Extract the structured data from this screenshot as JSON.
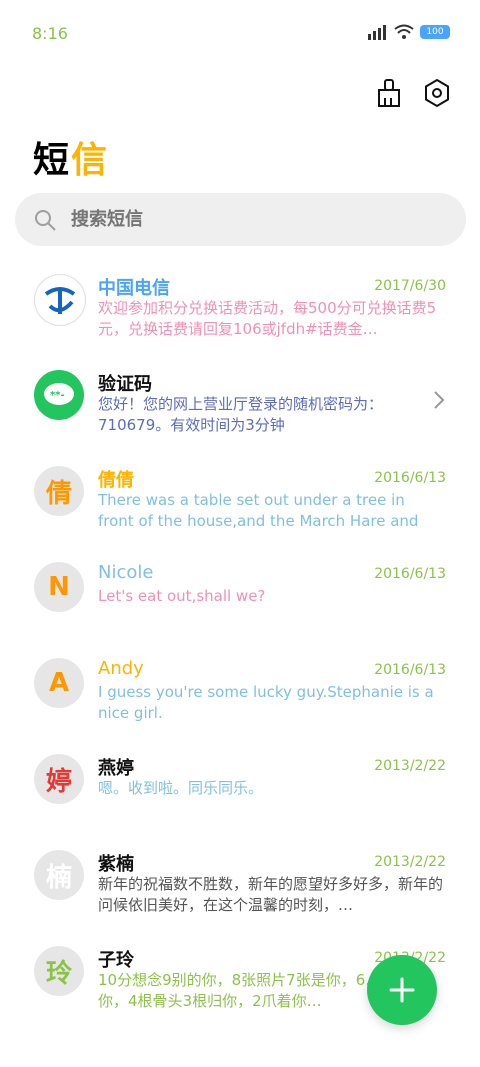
{
  "status_bar": {
    "time": "8:16",
    "battery": "100"
  },
  "header": {
    "title_part1": "短",
    "title_part2": "信",
    "actions": [
      "broom-icon",
      "settings-icon"
    ]
  },
  "search": {
    "placeholder": "搜索短信"
  },
  "messages": [
    {
      "name": "中国电信",
      "date": "2017/6/30",
      "avatar": "telecom-logo",
      "preview": "欢迎参加积分兑换话费活动，每500分可兑换话费5元，兑换话费请回复106或jfdh#话费金…"
    },
    {
      "name": "验证码",
      "date": "",
      "avatar": "message-logo",
      "preview": "您好！您的网上营业厅登录的随机密码为：710679。有效时间为3分钟"
    },
    {
      "name": "倩倩",
      "date": "2016/6/13",
      "avatar": "倩",
      "preview": "There was a table set out under a tree in front of the house,and the March Hare and the Hatte…"
    },
    {
      "name": "Nicole",
      "date": "2016/6/13",
      "avatar": "N",
      "preview": "Let's eat out,shall we?"
    },
    {
      "name": "Andy",
      "date": "2016/6/13",
      "avatar": "A",
      "preview": "I guess you're some lucky guy.Stephanie is a nice girl."
    },
    {
      "name": "燕婷",
      "date": "2013/2/22",
      "avatar": "婷",
      "preview": "嗯。收到啦。同乐同乐。"
    },
    {
      "name": "紫楠",
      "date": "2013/2/22",
      "avatar": "楠",
      "preview": "新年的祝福数不胜数，新年的愿望好多好多，新年的问候依旧美好，在这个温馨的时刻，…"
    },
    {
      "name": "子玲",
      "date": "2013/2/22",
      "avatar": "玲",
      "preview": "10分想念9别的你，8张照片7张是你，6…狗5只像你，4根骨头3根归你，2爪着你…"
    }
  ],
  "colors": {
    "accent": "#22c55e",
    "title_accent": "#ffb300",
    "date_green": "#8bc34a"
  }
}
